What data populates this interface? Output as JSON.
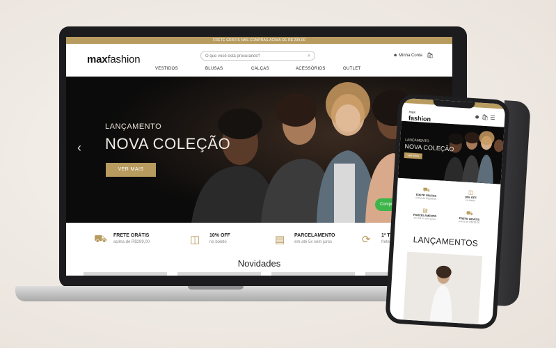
{
  "laptop": {
    "announcement": "FRETE GRÁTIS NAS COMPRAS ACIMA DE R$ 299,00",
    "logo": {
      "part1": "max",
      "part2": "fashion"
    },
    "search_placeholder": "O que você está procurando?",
    "search_icon": "search-icon",
    "account_label": "Minha Conta",
    "nav": [
      "VESTIDOS",
      "BLUSAS",
      "CALÇAS",
      "ACESSÓRIOS",
      "OUTLET"
    ],
    "hero": {
      "eyebrow": "LANÇAMENTO",
      "headline": "NOVA COLEÇÃO",
      "button": "VER MAIS",
      "arrow_icon": "chevron-left-icon"
    },
    "chat_button": "Compre",
    "features": [
      {
        "icon": "truck-icon",
        "title": "FRETE GRÁTIS",
        "subtitle": "acima de R$299,00"
      },
      {
        "icon": "ticket-icon",
        "title": "10% OFF",
        "subtitle": "no boleto"
      },
      {
        "icon": "card-icon",
        "title": "PARCELAMENTO",
        "subtitle": "em até 5x sem juros"
      },
      {
        "icon": "refresh-icon",
        "title": "1ª TROC",
        "subtitle": "frete grá"
      }
    ],
    "section_title": "Novidades"
  },
  "phone": {
    "logo_top": "max",
    "logo_bottom": "fashion",
    "hero": {
      "eyebrow": "LANÇAMENTO",
      "headline": "NOVA COLEÇÃO",
      "button": "VER MAIS"
    },
    "features": [
      {
        "icon": "truck-icon",
        "title": "FRETE GRÁTIS",
        "subtitle": "acima de R$299,00"
      },
      {
        "icon": "ticket-icon",
        "title": "10% OFF",
        "subtitle": "no boleto"
      },
      {
        "icon": "card-icon",
        "title": "PARCELAMENTO",
        "subtitle": "em até 5x sem juros"
      },
      {
        "icon": "truck-icon",
        "title": "FRETE GRÁTIS",
        "subtitle": "acima de R$299,00"
      }
    ],
    "section_title": "LANÇAMENTOS"
  },
  "colors": {
    "gold": "#b89b5e",
    "hero_bg": "#0b0b0b",
    "chat_green": "#3db54a"
  }
}
